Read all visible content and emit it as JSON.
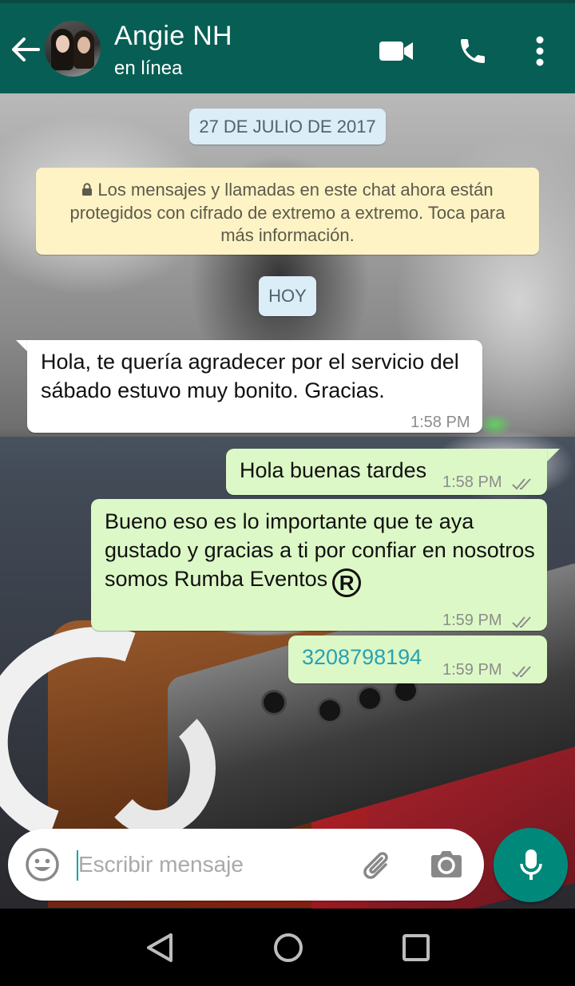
{
  "header": {
    "contact_name": "Angie NH",
    "status": "en línea",
    "background_color": "#075e54",
    "icons": [
      "back-arrow-icon",
      "video-call-icon",
      "phone-icon",
      "more-vert-icon"
    ]
  },
  "chat": {
    "date_separator_1": "27 DE JULIO DE 2017",
    "encryption_notice": "Los mensajes y llamadas en este chat ahora están protegidos con cifrado de extremo a extremo. Toca para más información.",
    "date_separator_2": "HOY",
    "messages": [
      {
        "direction": "incoming",
        "text": "Hola, te quería agradecer por el servicio del sábado estuvo muy bonito. Gracias.",
        "time": "1:58 PM"
      },
      {
        "direction": "outgoing",
        "text": "Hola buenas tardes",
        "time": "1:58 PM",
        "status": "read-double-check"
      },
      {
        "direction": "outgoing",
        "text": "Bueno eso es lo importante que te aya gustado y gracias a ti por confiar en nosotros somos Rumba Eventos",
        "symbol": "R",
        "time": "1:59 PM",
        "status": "read-double-check"
      },
      {
        "direction": "outgoing",
        "text": "3208798194",
        "time": "1:59 PM",
        "status": "read-double-check"
      }
    ],
    "colors": {
      "incoming_bubble": "#ffffff",
      "outgoing_bubble": "#dcf8c6",
      "date_chip": "#dbedf6",
      "notice": "#fdf3c4",
      "link": "#2aa1b1"
    }
  },
  "composer": {
    "placeholder": "Escribir mensaje",
    "icons": [
      "emoji-icon",
      "attach-icon",
      "camera-icon",
      "mic-icon"
    ],
    "mic_color": "#00897b"
  },
  "navbar": {
    "icons": [
      "nav-back-icon",
      "nav-home-icon",
      "nav-recent-icon"
    ]
  }
}
